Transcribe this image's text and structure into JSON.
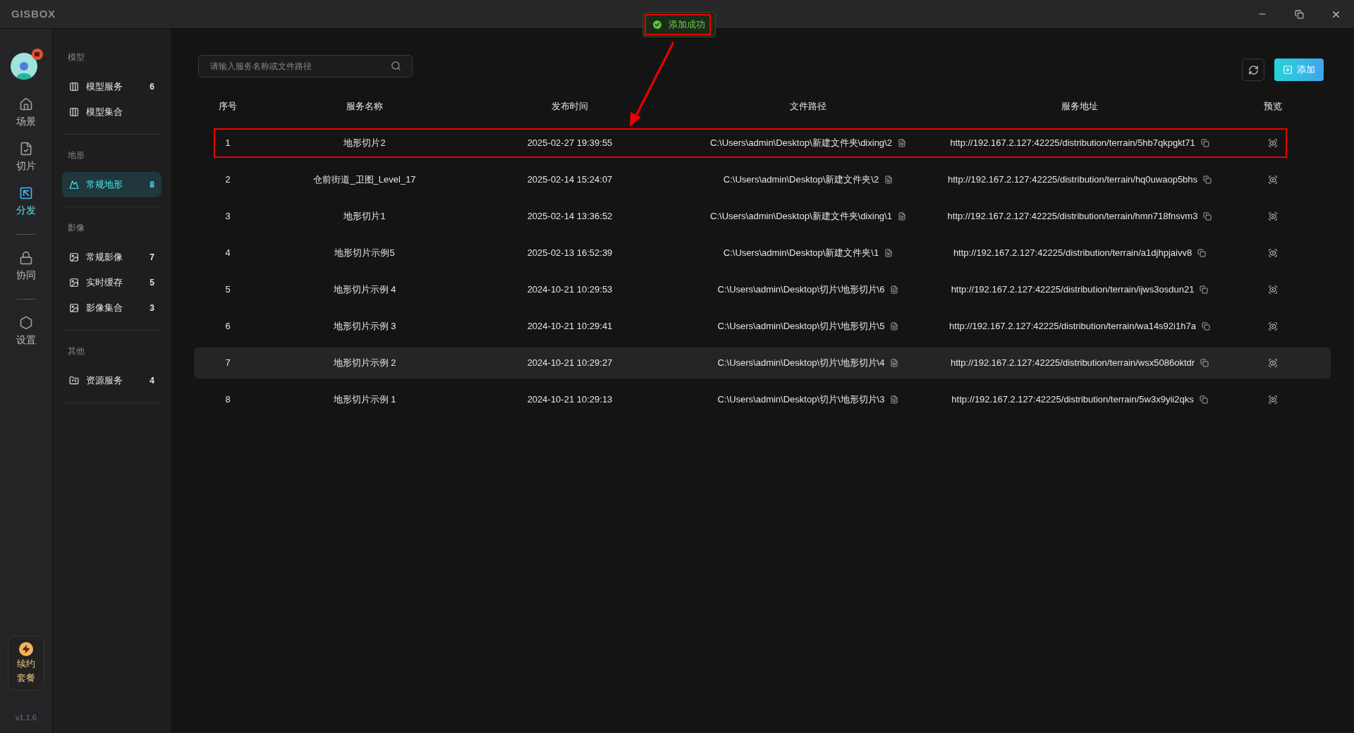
{
  "window": {
    "logo": "GISBOX"
  },
  "toast": {
    "text": "添加成功",
    "annotated": true
  },
  "rail": {
    "groups": [
      [
        {
          "label": "场景",
          "selected": false
        },
        {
          "label": "切片",
          "selected": false
        },
        {
          "label": "分发",
          "selected": true
        }
      ],
      [
        {
          "label": "协同",
          "selected": false
        }
      ],
      [
        {
          "label": "设置",
          "selected": false
        }
      ]
    ],
    "renew": {
      "lines": [
        "续约",
        "套餐"
      ]
    },
    "version": "v1.1.6"
  },
  "sidebar": {
    "sections": [
      {
        "title": "模型",
        "items": [
          {
            "label": "模型服务",
            "count": "6",
            "selected": false
          },
          {
            "label": "模型集合",
            "selected": false
          }
        ]
      },
      {
        "title": "地形",
        "items": [
          {
            "label": "常规地形",
            "count": "8",
            "selected": true
          }
        ]
      },
      {
        "title": "影像",
        "items": [
          {
            "label": "常规影像",
            "count": "7",
            "selected": false
          },
          {
            "label": "实时缓存",
            "count": "5",
            "selected": false
          },
          {
            "label": "影像集合",
            "count": "3",
            "selected": false
          }
        ]
      },
      {
        "title": "其他",
        "items": [
          {
            "label": "资源服务",
            "count": "4",
            "selected": false
          }
        ]
      }
    ]
  },
  "search": {
    "placeholder": "请输入服务名称或文件路径"
  },
  "toolbar": {
    "add_button": "添加"
  },
  "table": {
    "columns": [
      "序号",
      "服务名称",
      "发布时间",
      "文件路径",
      "服务地址",
      "预览"
    ],
    "rows": [
      {
        "cells": [
          "1",
          "地形切片2",
          "2025-02-27 19:39:55",
          "C:\\Users\\admin\\Desktop\\新建文件夹\\dixing\\2",
          "http://192.167.2.127:42225/distribution/terrain/5hb7qkpgkt71"
        ],
        "hovered": false,
        "annotated": true
      },
      {
        "cells": [
          "2",
          "仓前街道_卫图_Level_17",
          "2025-02-14 15:24:07",
          "C:\\Users\\admin\\Desktop\\新建文件夹\\2",
          "http://192.167.2.127:42225/distribution/terrain/hq0uwaop5bhs"
        ],
        "hovered": false,
        "annotated": false
      },
      {
        "cells": [
          "3",
          "地形切片1",
          "2025-02-14 13:36:52",
          "C:\\Users\\admin\\Desktop\\新建文件夹\\dixing\\1",
          "http://192.167.2.127:42225/distribution/terrain/hmn718fnsvm3"
        ],
        "hovered": false,
        "annotated": false
      },
      {
        "cells": [
          "4",
          "地形切片示例5",
          "2025-02-13 16:52:39",
          "C:\\Users\\admin\\Desktop\\新建文件夹\\1",
          "http://192.167.2.127:42225/distribution/terrain/a1djhpjaivv8"
        ],
        "hovered": false,
        "annotated": false
      },
      {
        "cells": [
          "5",
          "地形切片示例 4",
          "2024-10-21 10:29:53",
          "C:\\Users\\admin\\Desktop\\切片\\地形切片\\6",
          "http://192.167.2.127:42225/distribution/terrain/ijws3osdun21"
        ],
        "hovered": false,
        "annotated": false
      },
      {
        "cells": [
          "6",
          "地形切片示例 3",
          "2024-10-21 10:29:41",
          "C:\\Users\\admin\\Desktop\\切片\\地形切片\\5",
          "http://192.167.2.127:42225/distribution/terrain/wa14s92i1h7a"
        ],
        "hovered": false,
        "annotated": false
      },
      {
        "cells": [
          "7",
          "地形切片示例 2",
          "2024-10-21 10:29:27",
          "C:\\Users\\admin\\Desktop\\切片\\地形切片\\4",
          "http://192.167.2.127:42225/distribution/terrain/wsx5086oktdr"
        ],
        "hovered": true,
        "annotated": false
      },
      {
        "cells": [
          "8",
          "地形切片示例 1",
          "2024-10-21 10:29:13",
          "C:\\Users\\admin\\Desktop\\切片\\地形切片\\3",
          "http://192.167.2.127:42225/distribution/terrain/5w3x9yii2qks"
        ],
        "hovered": false,
        "annotated": false
      }
    ]
  }
}
